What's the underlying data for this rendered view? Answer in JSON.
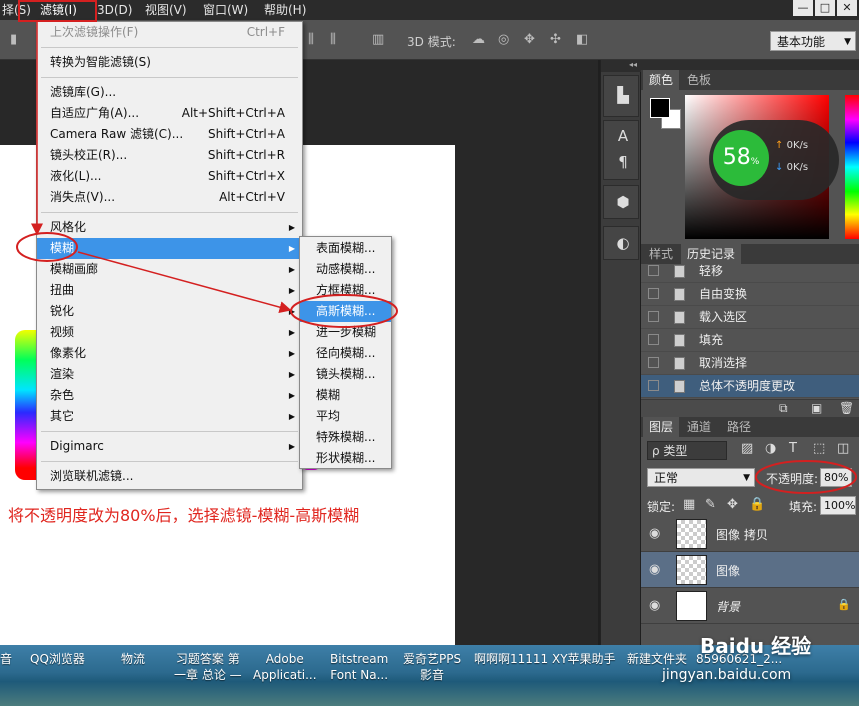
{
  "menubar": {
    "items": [
      "择(S)",
      "滤镜(I)",
      "3D(D)",
      "视图(V)",
      "窗口(W)",
      "帮助(H)"
    ],
    "window_buttons": [
      "—",
      "□",
      "✕"
    ]
  },
  "options_bar": {
    "mode_label": "3D 模式:",
    "workspace": "基本功能"
  },
  "filter_menu": {
    "last_filter": {
      "label": "上次滤镜操作(F)",
      "shortcut": "Ctrl+F"
    },
    "smart": "转换为智能滤镜(S)",
    "gallery": {
      "label": "滤镜库(G)..."
    },
    "adaptive": {
      "label": "自适应广角(A)...",
      "shortcut": "Alt+Shift+Ctrl+A"
    },
    "camera_raw": {
      "label": "Camera Raw 滤镜(C)...",
      "shortcut": "Shift+Ctrl+A"
    },
    "lens": {
      "label": "镜头校正(R)...",
      "shortcut": "Shift+Ctrl+R"
    },
    "liquify": {
      "label": "液化(L)...",
      "shortcut": "Shift+Ctrl+X"
    },
    "vanishing": {
      "label": "消失点(V)...",
      "shortcut": "Alt+Ctrl+V"
    },
    "stylize": "风格化",
    "blur": "模糊",
    "blur_gallery": "模糊画廊",
    "distort": "扭曲",
    "sharpen": "锐化",
    "video": "视频",
    "pixelate": "像素化",
    "render": "渲染",
    "noise": "杂色",
    "other": "其它",
    "digimarc": "Digimarc",
    "browse": "浏览联机滤镜..."
  },
  "blur_submenu": {
    "items": [
      "表面模糊...",
      "动感模糊...",
      "方框模糊...",
      "高斯模糊...",
      "进一步模糊",
      "径向模糊...",
      "镜头模糊...",
      "模糊",
      "平均",
      "特殊模糊...",
      "形状模糊..."
    ]
  },
  "annotation": "将不透明度改为80%后，选择滤镜-模糊-高斯模糊",
  "color_panel": {
    "tabs": [
      "颜色",
      "色板"
    ],
    "overlay_percent": "58",
    "overlay_percent_sign": "%",
    "upload_speed": "0K/s",
    "download_speed": "0K/s",
    "up_arrow": "↑",
    "down_arrow": "↓"
  },
  "history_panel": {
    "tabs": [
      "样式",
      "历史记录"
    ],
    "items": [
      "轻移",
      "自由变换",
      "载入选区",
      "填充",
      "取消选择",
      "总体不透明度更改"
    ]
  },
  "layers_panel": {
    "tabs": [
      "图层",
      "通道",
      "路径"
    ],
    "kind": "ρ 类型",
    "blend_mode": "正常",
    "opacity_label": "不透明度:",
    "opacity_value": "80%",
    "lock_label": "锁定:",
    "fill_label": "填充:",
    "fill_value": "100%",
    "layers": [
      {
        "name": "图像 拷贝"
      },
      {
        "name": "图像"
      },
      {
        "name": "背景"
      }
    ]
  },
  "taskbar": {
    "items": [
      {
        "line1": "音",
        "line2": ""
      },
      {
        "line1": "QQ浏览器",
        "line2": ""
      },
      {
        "line1": "物流",
        "line2": ""
      },
      {
        "line1": "习题答案 第",
        "line2": "一章 总论 —"
      },
      {
        "line1": "Adobe",
        "line2": "Applicati..."
      },
      {
        "line1": "Bitstream",
        "line2": "Font Na..."
      },
      {
        "line1": "爱奇艺PPS",
        "line2": "影音"
      },
      {
        "line1": "啊啊啊11111",
        "line2": ""
      },
      {
        "line1": "XY苹果助手",
        "line2": ""
      },
      {
        "line1": "新建文件夹",
        "line2": ""
      },
      {
        "line1": "85960621_2...",
        "line2": ""
      }
    ]
  },
  "watermark": {
    "brand": "Baidu 经验",
    "url": "jingyan.baidu.com"
  },
  "colors": {
    "accent": "#3d94e8",
    "annotation_red": "#e0261f"
  }
}
